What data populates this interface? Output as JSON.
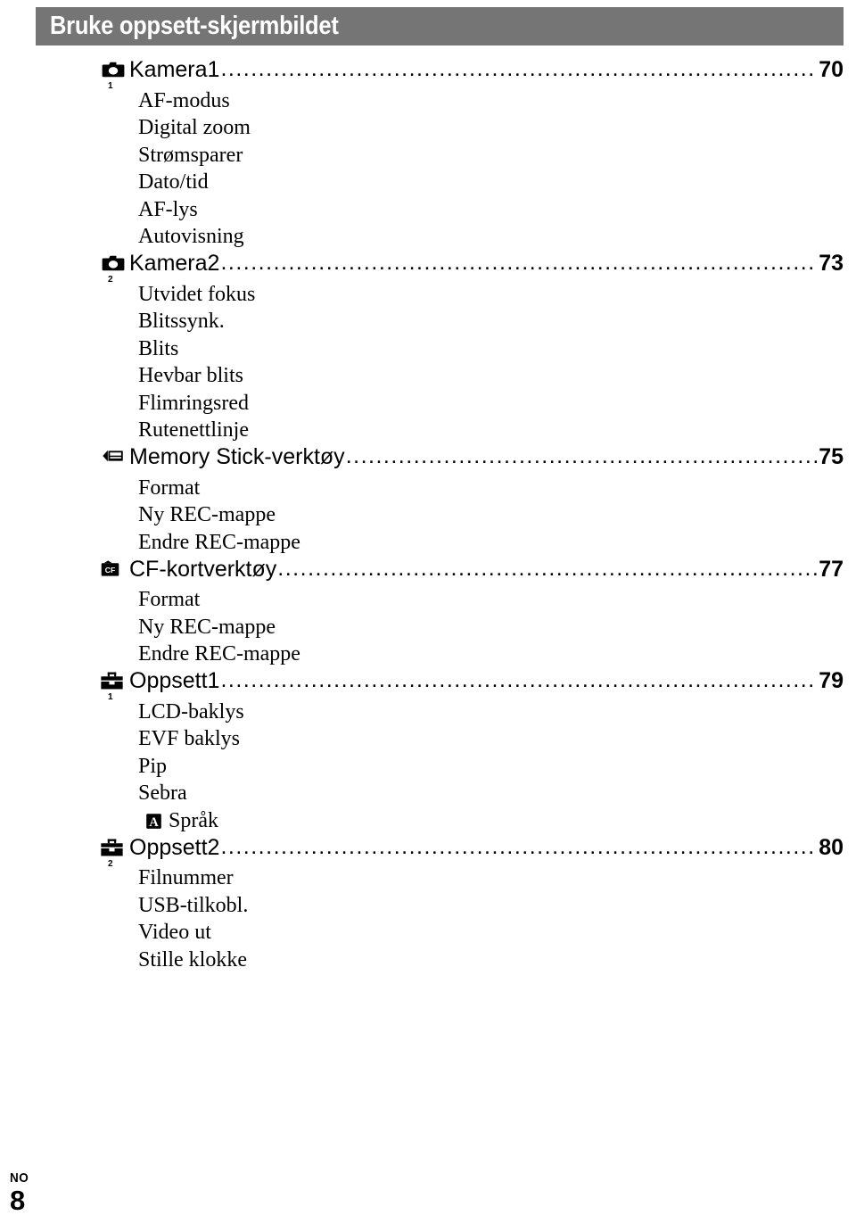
{
  "header": {
    "title": "Bruke oppsett-skjermbildet",
    "bar_color": "#757575",
    "title_color": "#ffffff"
  },
  "toc": {
    "leader_char": ".",
    "sections": [
      {
        "icon": "camera-icon",
        "icon_index": "1",
        "label": "Kamera1",
        "page": "70",
        "items": [
          {
            "label": "AF-modus"
          },
          {
            "label": "Digital zoom"
          },
          {
            "label": "Strømsparer"
          },
          {
            "label": "Dato/tid"
          },
          {
            "label": "AF-lys"
          },
          {
            "label": "Autovisning"
          }
        ]
      },
      {
        "icon": "camera-icon",
        "icon_index": "2",
        "label": "Kamera2",
        "page": "73",
        "items": [
          {
            "label": "Utvidet fokus"
          },
          {
            "label": "Blitssynk."
          },
          {
            "label": "Blits"
          },
          {
            "label": "Hevbar blits"
          },
          {
            "label": "Flimringsred"
          },
          {
            "label": "Rutenettlinje"
          }
        ]
      },
      {
        "icon": "memory-stick-icon",
        "icon_index": "",
        "label": "Memory Stick-verktøy",
        "page": "75",
        "items": [
          {
            "label": "Format"
          },
          {
            "label": "Ny REC-mappe"
          },
          {
            "label": "Endre REC-mappe"
          }
        ]
      },
      {
        "icon": "cf-card-icon",
        "icon_index": "",
        "label": "CF-kortverktøy",
        "page": "77",
        "items": [
          {
            "label": "Format"
          },
          {
            "label": "Ny REC-mappe"
          },
          {
            "label": "Endre REC-mappe"
          }
        ]
      },
      {
        "icon": "toolbox-icon",
        "icon_index": "1",
        "label": "Oppsett1",
        "page": "79",
        "items": [
          {
            "label": "LCD-baklys"
          },
          {
            "label": "EVF baklys"
          },
          {
            "label": "Pip"
          },
          {
            "label": "Sebra"
          },
          {
            "label": "Språk",
            "icon": "language-a-icon"
          }
        ]
      },
      {
        "icon": "toolbox-icon",
        "icon_index": "2",
        "label": "Oppsett2",
        "page": "80",
        "items": [
          {
            "label": "Filnummer"
          },
          {
            "label": "USB-tilkobl."
          },
          {
            "label": "Video ut"
          },
          {
            "label": "Stille klokke"
          }
        ]
      }
    ]
  },
  "footer": {
    "language_code": "NO",
    "page_number": "8"
  }
}
